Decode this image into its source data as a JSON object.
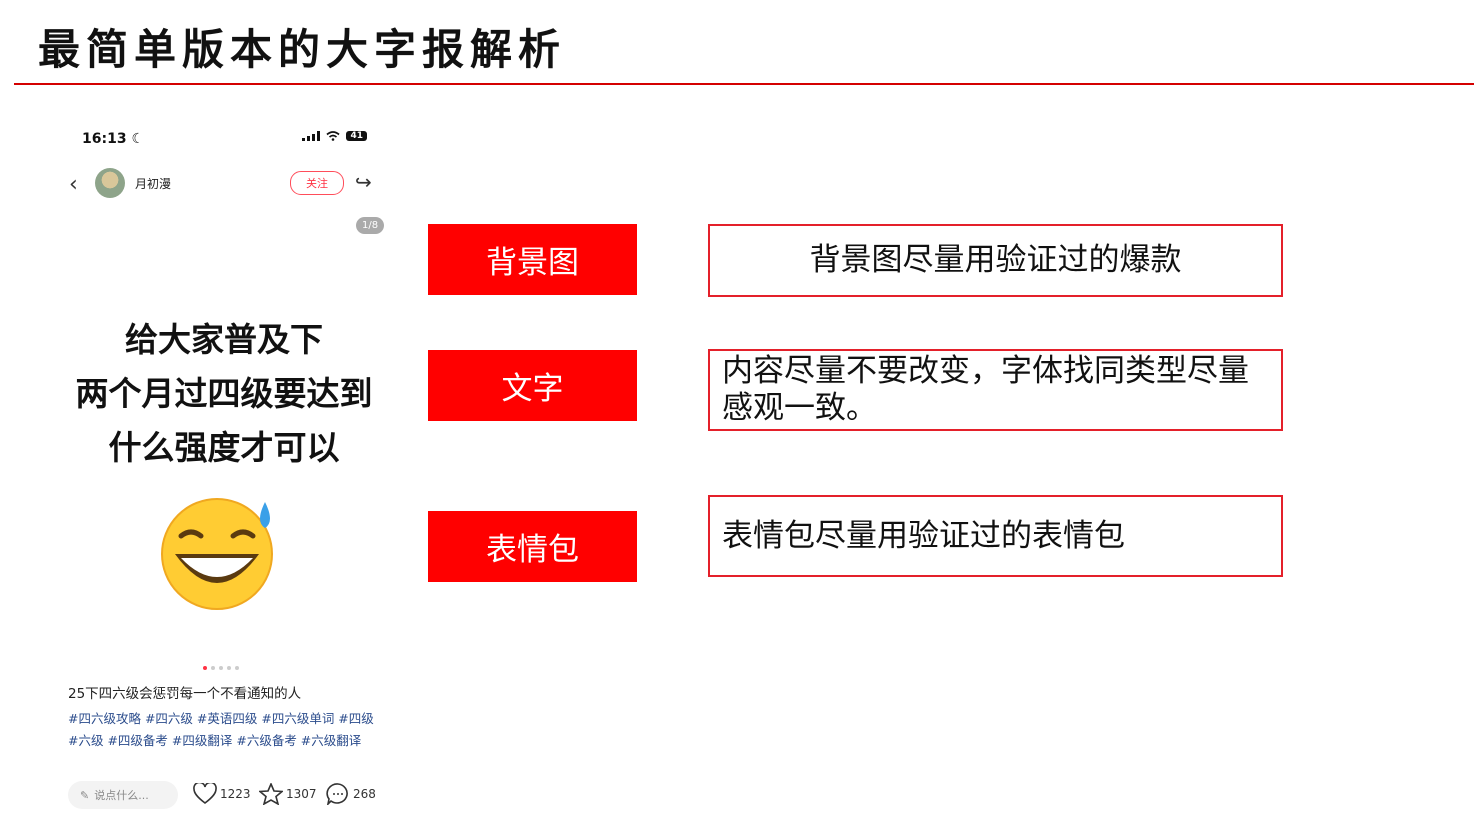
{
  "slide": {
    "title": "最简单版本的大字报解析"
  },
  "phone": {
    "status": {
      "time": "16:13",
      "moon": "☾",
      "battery": "41"
    },
    "header": {
      "back": "‹",
      "username": "月初漫",
      "follow": "关注",
      "share": "↪"
    },
    "pager": "1/8",
    "post_text": [
      "给大家普及下",
      "两个月过四级要达到",
      "什么强度才可以"
    ],
    "caption": "25下四六级会惩罚每一个不看通知的人",
    "tags": "#四六级攻略 #四六级 #英语四级 #四六级单词 #四级 #六级 #四级备考 #四级翻译 #六级备考 #六级翻译",
    "comment_placeholder": "说点什么...",
    "stats": {
      "likes": "1223",
      "stars": "1307",
      "comments": "268"
    }
  },
  "rows": [
    {
      "label": "背景图",
      "desc": "背景图尽量用验证过的爆款"
    },
    {
      "label": "文字",
      "desc": "内容尽量不要改变，字体找同类型尽量感观一致。"
    },
    {
      "label": "表情包",
      "desc": "表情包尽量用验证过的表情包"
    }
  ],
  "colors": {
    "accent": "#ff0000",
    "rule": "#d40000",
    "border": "#e4202a"
  }
}
